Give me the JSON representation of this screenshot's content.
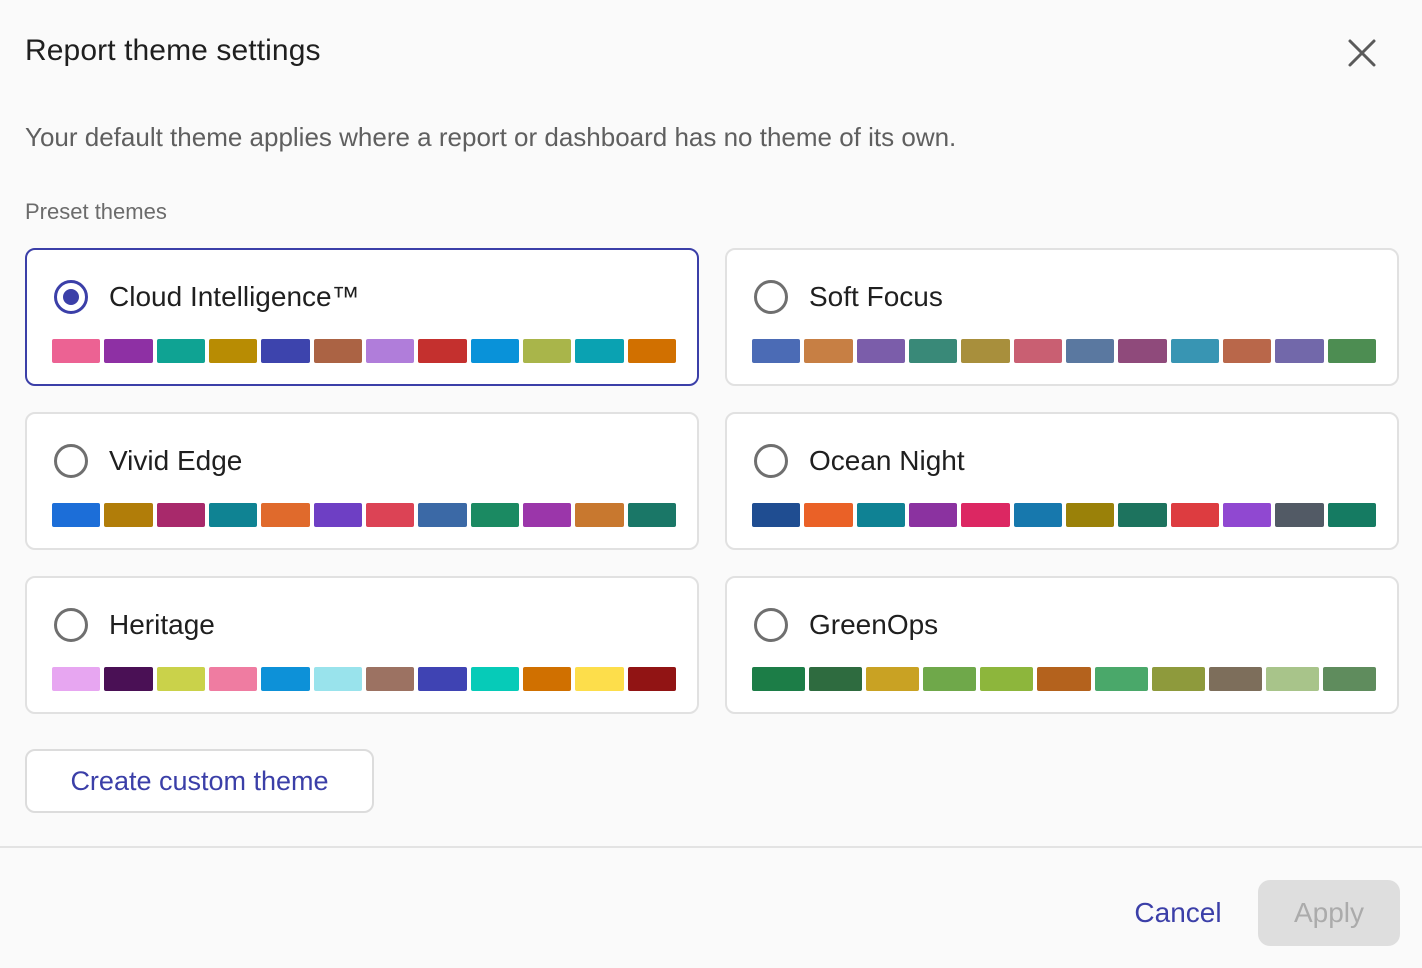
{
  "dialog": {
    "title": "Report theme settings",
    "close_icon": "close-icon",
    "description": "Your default theme applies where a report or dashboard has no theme of its own.",
    "section_label": "Preset themes"
  },
  "themes": [
    {
      "name": "Cloud Intelligence™",
      "selected": true,
      "colors": [
        "#ec6293",
        "#8e30a4",
        "#0fa393",
        "#b88c03",
        "#3d44ad",
        "#ab6344",
        "#b07dda",
        "#c4302e",
        "#0992d9",
        "#a9b54a",
        "#0aa2b2",
        "#d17000"
      ]
    },
    {
      "name": "Soft Focus",
      "selected": false,
      "colors": [
        "#4b6bb5",
        "#c77f44",
        "#7b5daa",
        "#398978",
        "#a88f3c",
        "#c95f72",
        "#5a78a0",
        "#8f4a7b",
        "#3895b3",
        "#b9674a",
        "#7268aa",
        "#4d8d52"
      ]
    },
    {
      "name": "Vivid Edge",
      "selected": false,
      "colors": [
        "#1c6ed8",
        "#b17d09",
        "#a8296b",
        "#0f8393",
        "#e06a2c",
        "#6e3fc4",
        "#dc4355",
        "#3b69a6",
        "#1b8a62",
        "#9b36aa",
        "#c8782f",
        "#1a7767"
      ]
    },
    {
      "name": "Ocean Night",
      "selected": false,
      "colors": [
        "#1f4d91",
        "#ea6127",
        "#0f8294",
        "#8b32a0",
        "#dc2762",
        "#1778ad",
        "#9a8109",
        "#1d735e",
        "#dd3c40",
        "#9048d1",
        "#525a65",
        "#157b62"
      ]
    },
    {
      "name": "Heritage",
      "selected": false,
      "colors": [
        "#e7a6f1",
        "#4a1055",
        "#cad24a",
        "#ef7ca1",
        "#0d91d8",
        "#99e3ec",
        "#9c7262",
        "#3f43b3",
        "#06cbb8",
        "#d07000",
        "#fdde4b",
        "#911414"
      ]
    },
    {
      "name": "GreenOps",
      "selected": false,
      "colors": [
        "#1c7d47",
        "#2e6b3f",
        "#c9a223",
        "#6fa84a",
        "#8db63c",
        "#b4621d",
        "#4aa86a",
        "#8e9a3c",
        "#7d6e5b",
        "#a8c48a",
        "#5f8c5d"
      ]
    }
  ],
  "actions": {
    "create_custom": "Create custom theme",
    "cancel": "Cancel",
    "apply": "Apply"
  },
  "colors": {
    "accent": "#3b3fa8",
    "disabled_bg": "#dedede",
    "disabled_text": "#ababab"
  }
}
